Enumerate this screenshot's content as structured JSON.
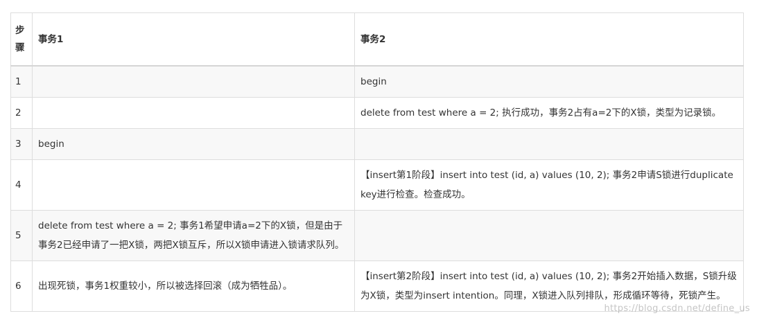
{
  "table": {
    "headers": {
      "step": "步骤",
      "txn1": "事务1",
      "txn2": "事务2"
    },
    "rows": [
      {
        "step": "1",
        "txn1": "",
        "txn2": "begin"
      },
      {
        "step": "2",
        "txn1": "",
        "txn2": "delete from test where a = 2; 执行成功，事务2占有a=2下的X锁，类型为记录锁。"
      },
      {
        "step": "3",
        "txn1": "begin",
        "txn2": ""
      },
      {
        "step": "4",
        "txn1": "",
        "txn2": "【insert第1阶段】insert into test (id, a) values (10, 2); 事务2申请S锁进行duplicate key进行检查。检查成功。"
      },
      {
        "step": "5",
        "txn1": "delete from test where a = 2; 事务1希望申请a=2下的X锁，但是由于事务2已经申请了一把X锁，两把X锁互斥，所以X锁申请进入锁请求队列。",
        "txn2": ""
      },
      {
        "step": "6",
        "txn1": "出现死锁，事务1权重较小，所以被选择回滚（成为牺牲品）。",
        "txn2": "【insert第2阶段】insert into test (id, a) values (10, 2); 事务2开始插入数据，S锁升级为X锁，类型为insert intention。同理，X锁进入队列排队，形成循环等待，死锁产生。"
      }
    ]
  },
  "watermark": "https://blog.csdn.net/define_us"
}
